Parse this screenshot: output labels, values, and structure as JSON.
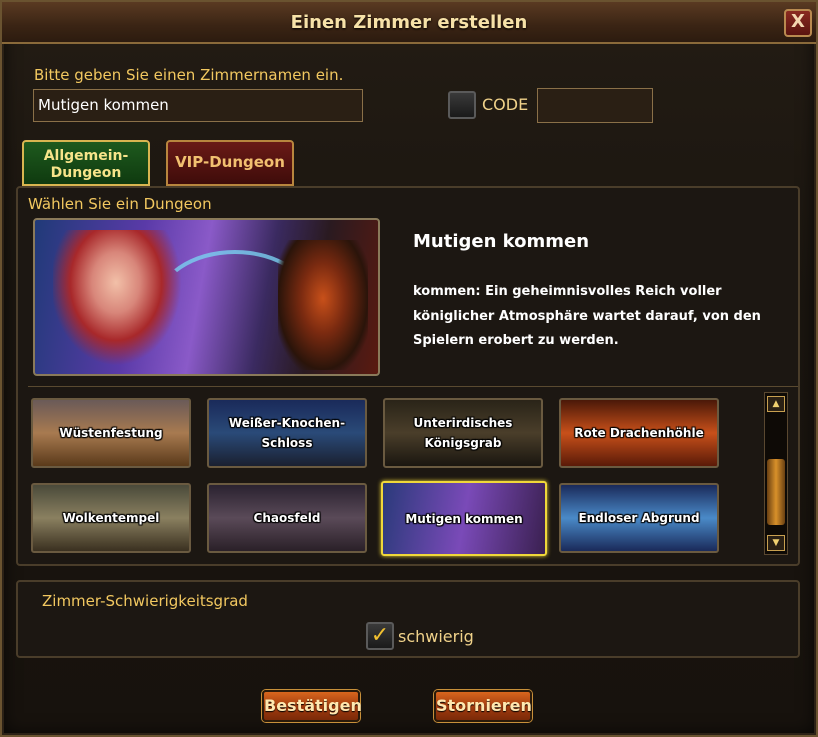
{
  "window": {
    "title": "Einen Zimmer erstellen",
    "close_label": "X"
  },
  "room_name": {
    "prompt": "Bitte geben Sie einen Zimmernamen ein.",
    "value": "Mutigen kommen"
  },
  "code": {
    "label": "CODE",
    "checked": false,
    "value": ""
  },
  "tabs": [
    {
      "label": "Allgemein-Dungeon",
      "active": true
    },
    {
      "label": "VIP-Dungeon",
      "active": false
    }
  ],
  "dungeon_panel": {
    "heading": "Wählen Sie ein Dungeon",
    "selected": {
      "title": "Mutigen kommen",
      "description": "kommen: Ein geheimnisvolles Reich voller königlicher Atmosphäre wartet darauf, von den Spielern erobert zu werden."
    },
    "dungeons": [
      {
        "label": "Wüstenfestung",
        "selected": false
      },
      {
        "label": "Weißer-Knochen-Schloss",
        "selected": false
      },
      {
        "label": "Unterirdisches Königsgrab",
        "selected": false
      },
      {
        "label": "Rote Drachenhöhle",
        "selected": false
      },
      {
        "label": "Wolkentempel",
        "selected": false
      },
      {
        "label": "Chaosfeld",
        "selected": false
      },
      {
        "label": "Mutigen kommen",
        "selected": true
      },
      {
        "label": "Endloser Abgrund",
        "selected": false
      }
    ],
    "scroll_up_icon": "triangle-up",
    "scroll_down_icon": "triangle-down"
  },
  "difficulty": {
    "heading": "Zimmer-Schwierigkeitsgrad",
    "option_label": "schwierig",
    "checked": true,
    "check_mark": "✓"
  },
  "buttons": {
    "confirm": "Bestätigen",
    "cancel": "Stornieren"
  },
  "colors": {
    "accent_gold": "#f2c860",
    "selected_border": "#f0d83a",
    "button_orange": "#c8501a"
  }
}
